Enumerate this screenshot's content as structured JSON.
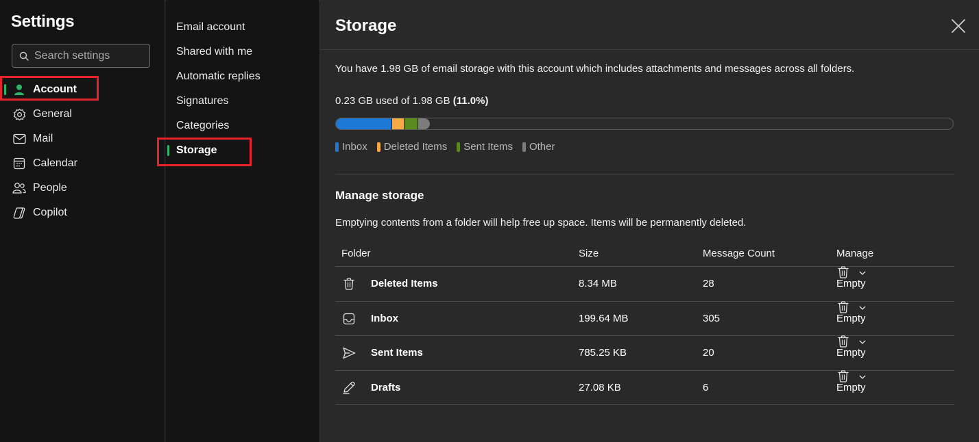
{
  "nav": {
    "title": "Settings",
    "search_placeholder": "Search settings",
    "items": [
      {
        "label": "Account",
        "icon": "person-icon",
        "active": true
      },
      {
        "label": "General",
        "icon": "gear-icon"
      },
      {
        "label": "Mail",
        "icon": "mail-icon"
      },
      {
        "label": "Calendar",
        "icon": "calendar-icon"
      },
      {
        "label": "People",
        "icon": "people-icon"
      },
      {
        "label": "Copilot",
        "icon": "copilot-icon"
      }
    ]
  },
  "subnav": {
    "items": [
      {
        "label": "Email account"
      },
      {
        "label": "Shared with me"
      },
      {
        "label": "Automatic replies"
      },
      {
        "label": "Signatures"
      },
      {
        "label": "Categories"
      },
      {
        "label": "Storage",
        "active": true
      }
    ]
  },
  "main": {
    "title": "Storage",
    "description": "You have 1.98 GB of email storage with this account which includes attachments and messages across all folders.",
    "usage_prefix": "0.23 GB used of 1.98 GB",
    "usage_percent": "(11.0%)",
    "usage_fraction": 0.11,
    "segments": [
      {
        "name": "Inbox",
        "share": 0.6,
        "color": "#1e78d6"
      },
      {
        "name": "Deleted Items",
        "share": 0.13,
        "color": "#f6a944"
      },
      {
        "name": "Sent Items",
        "share": 0.15,
        "color": "#5a8a1e"
      },
      {
        "name": "Other",
        "share": 0.12,
        "color": "#7c7c7c"
      }
    ],
    "legend": [
      {
        "label": "Inbox",
        "color": "#1e78d6"
      },
      {
        "label": "Deleted Items",
        "color": "#f6a944"
      },
      {
        "label": "Sent Items",
        "color": "#5a8a1e"
      },
      {
        "label": "Other",
        "color": "#7c7c7c"
      }
    ],
    "manage_title": "Manage storage",
    "manage_description": "Emptying contents from a folder will help free up space. Items will be permanently deleted.",
    "table": {
      "headers": {
        "folder": "Folder",
        "size": "Size",
        "count": "Message Count",
        "manage": "Manage"
      },
      "rows": [
        {
          "folder": "Deleted Items",
          "icon": "trash-icon",
          "size": "8.34 MB",
          "count": "28",
          "action": "Empty"
        },
        {
          "folder": "Inbox",
          "icon": "inbox-icon",
          "size": "199.64 MB",
          "count": "305",
          "action": "Empty"
        },
        {
          "folder": "Sent Items",
          "icon": "send-icon",
          "size": "785.25 KB",
          "count": "20",
          "action": "Empty"
        },
        {
          "folder": "Drafts",
          "icon": "drafts-icon",
          "size": "27.08 KB",
          "count": "6",
          "action": "Empty"
        }
      ]
    }
  },
  "colors": {
    "accent_indicator": "#2fb56a",
    "highlight_box": "#e8222b"
  }
}
